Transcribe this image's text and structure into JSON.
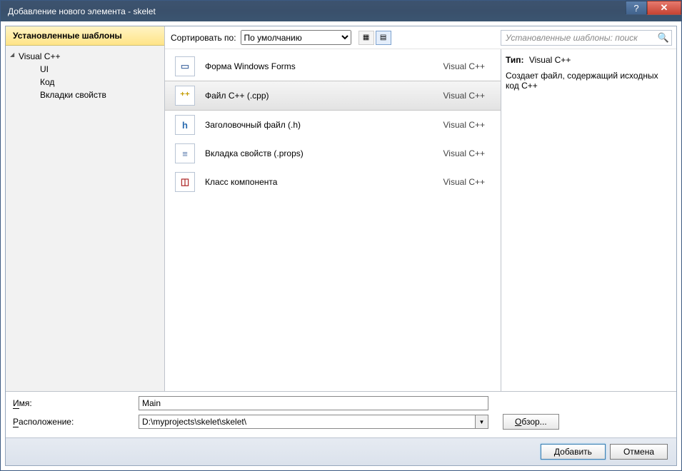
{
  "window": {
    "title": "Добавление нового элемента - skelet"
  },
  "sidebar": {
    "header": "Установленные шаблоны",
    "root": "Visual C++",
    "children": [
      "UI",
      "Код",
      "Вкладки свойств"
    ]
  },
  "toolbar": {
    "sort_label": "Сортировать по:",
    "sort_options": [
      "По умолчанию"
    ],
    "sort_selected": "По умолчанию"
  },
  "search": {
    "placeholder": "Установленные шаблоны: поиск"
  },
  "items": [
    {
      "name": "Форма Windows Forms",
      "lang": "Visual C++",
      "icon": "form"
    },
    {
      "name": "Файл C++ (.cpp)",
      "lang": "Visual C++",
      "icon": "cpp",
      "selected": true
    },
    {
      "name": "Заголовочный файл (.h)",
      "lang": "Visual C++",
      "icon": "h"
    },
    {
      "name": "Вкладка свойств (.props)",
      "lang": "Visual C++",
      "icon": "props"
    },
    {
      "name": "Класс компонента",
      "lang": "Visual C++",
      "icon": "comp"
    }
  ],
  "details": {
    "type_label": "Тип:",
    "type_value": "Visual C++",
    "description": "Создает файл, содержащий исходных код C++"
  },
  "form": {
    "name_label_u": "И",
    "name_label_rest": "мя:",
    "name_value": "Main",
    "loc_label_u": "Р",
    "loc_label_rest": "асположение:",
    "loc_value": "D:\\myprojects\\skelet\\skelet\\",
    "browse_label_u": "О",
    "browse_label_rest": "бзор..."
  },
  "footer": {
    "add_label_u": "Д",
    "add_label_rest": "обавить",
    "cancel_label": "Отмена"
  },
  "icons": {
    "form": "▭",
    "cpp": "⁺⁺",
    "h": "h",
    "props": "≡",
    "comp": "◫"
  }
}
